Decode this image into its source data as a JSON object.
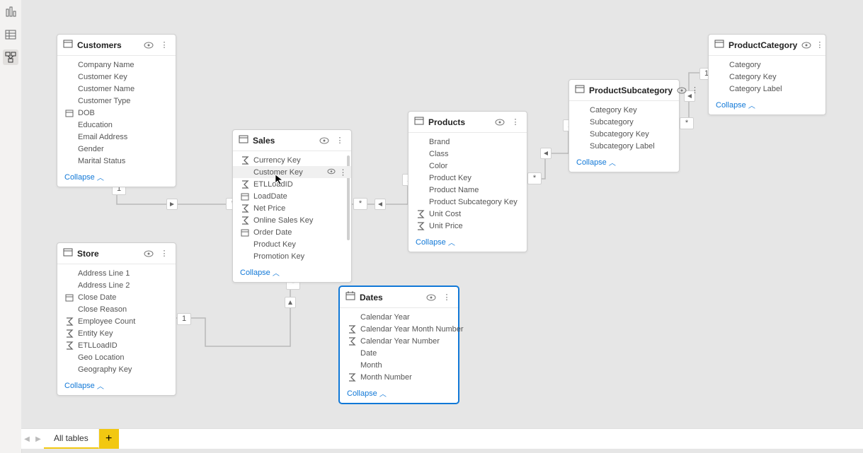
{
  "collapse_label": "Collapse",
  "cardinality": {
    "one": "1",
    "many": "*"
  },
  "left_rail": {
    "report_tooltip": "Report view",
    "data_tooltip": "Data view",
    "model_tooltip": "Model view"
  },
  "tables": {
    "customers": {
      "name": "Customers",
      "fields": [
        {
          "label": "Company Name",
          "icon": ""
        },
        {
          "label": "Customer Key",
          "icon": ""
        },
        {
          "label": "Customer Name",
          "icon": ""
        },
        {
          "label": "Customer Type",
          "icon": ""
        },
        {
          "label": "DOB",
          "icon": "date"
        },
        {
          "label": "Education",
          "icon": ""
        },
        {
          "label": "Email Address",
          "icon": ""
        },
        {
          "label": "Gender",
          "icon": ""
        },
        {
          "label": "Marital Status",
          "icon": ""
        }
      ]
    },
    "sales": {
      "name": "Sales",
      "fields": [
        {
          "label": "Currency Key",
          "icon": "sum"
        },
        {
          "label": "Customer Key",
          "icon": "",
          "highlight": true
        },
        {
          "label": "ETLLoadID",
          "icon": "sum"
        },
        {
          "label": "LoadDate",
          "icon": "date"
        },
        {
          "label": "Net Price",
          "icon": "sum"
        },
        {
          "label": "Online Sales Key",
          "icon": "sum"
        },
        {
          "label": "Order Date",
          "icon": "date"
        },
        {
          "label": "Product Key",
          "icon": ""
        },
        {
          "label": "Promotion Key",
          "icon": ""
        }
      ]
    },
    "products": {
      "name": "Products",
      "fields": [
        {
          "label": "Brand",
          "icon": ""
        },
        {
          "label": "Class",
          "icon": ""
        },
        {
          "label": "Color",
          "icon": ""
        },
        {
          "label": "Product Key",
          "icon": ""
        },
        {
          "label": "Product Name",
          "icon": ""
        },
        {
          "label": "Product Subcategory Key",
          "icon": ""
        },
        {
          "label": "Unit Cost",
          "icon": "sum"
        },
        {
          "label": "Unit Price",
          "icon": "sum"
        }
      ]
    },
    "subcategory": {
      "name": "ProductSubcategory",
      "fields": [
        {
          "label": "Category Key",
          "icon": ""
        },
        {
          "label": "Subcategory",
          "icon": ""
        },
        {
          "label": "Subcategory Key",
          "icon": ""
        },
        {
          "label": "Subcategory Label",
          "icon": ""
        }
      ]
    },
    "category": {
      "name": "ProductCategory",
      "fields": [
        {
          "label": "Category",
          "icon": ""
        },
        {
          "label": "Category Key",
          "icon": ""
        },
        {
          "label": "Category Label",
          "icon": ""
        }
      ]
    },
    "store": {
      "name": "Store",
      "fields": [
        {
          "label": "Address Line 1",
          "icon": ""
        },
        {
          "label": "Address Line 2",
          "icon": ""
        },
        {
          "label": "Close Date",
          "icon": "date"
        },
        {
          "label": "Close Reason",
          "icon": ""
        },
        {
          "label": "Employee Count",
          "icon": "sum"
        },
        {
          "label": "Entity Key",
          "icon": "sum"
        },
        {
          "label": "ETLLoadID",
          "icon": "sum"
        },
        {
          "label": "Geo Location",
          "icon": ""
        },
        {
          "label": "Geography Key",
          "icon": ""
        }
      ]
    },
    "dates": {
      "name": "Dates",
      "fields": [
        {
          "label": "Calendar Year",
          "icon": ""
        },
        {
          "label": "Calendar Year Month Number",
          "icon": "sum"
        },
        {
          "label": "Calendar Year Number",
          "icon": "sum"
        },
        {
          "label": "Date",
          "icon": ""
        },
        {
          "label": "Month",
          "icon": ""
        },
        {
          "label": "Month Number",
          "icon": "sum"
        }
      ]
    }
  },
  "bottom_bar": {
    "tab_label": "All tables"
  }
}
